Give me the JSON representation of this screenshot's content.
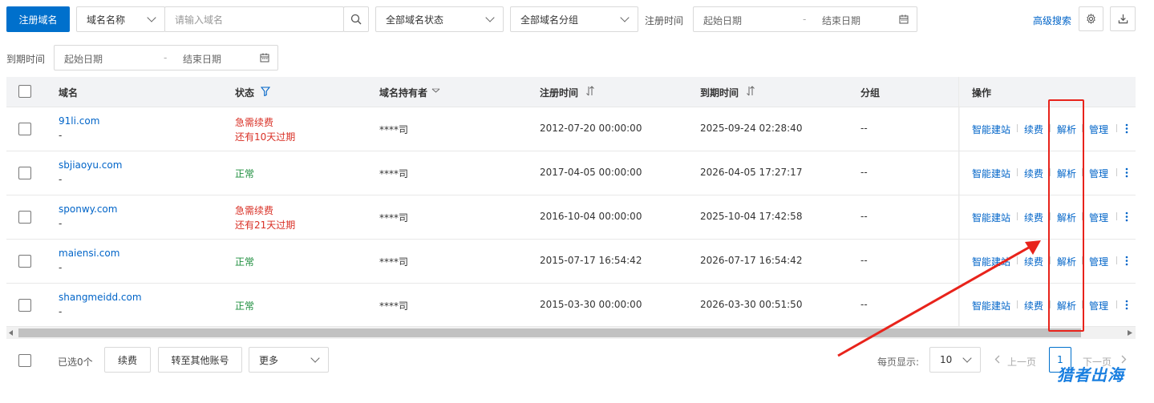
{
  "toolbar": {
    "register_label": "注册域名",
    "field_select": "域名名称",
    "search_placeholder": "请输入域名",
    "status_select": "全部域名状态",
    "group_select": "全部域名分组",
    "reg_time_label": "注册时间",
    "start_date": "起始日期",
    "dash": "-",
    "end_date": "结束日期",
    "advanced_search": "高级搜索",
    "expire_time_label": "到期时间"
  },
  "table": {
    "headers": {
      "domain": "域名",
      "status": "状态",
      "holder": "域名持有者",
      "reg_time": "注册时间",
      "expire_time": "到期时间",
      "group": "分组",
      "ops": "操作"
    },
    "ops": {
      "site": "智能建站",
      "renew": "续费",
      "dns": "解析",
      "manage": "管理"
    },
    "rows": [
      {
        "domain": "91li.com",
        "sub": "-",
        "status1": "急需续费",
        "status2": "还有10天过期",
        "holder": "****司",
        "reg": "2012-07-20 00:00:00",
        "exp": "2025-09-24 02:28:40",
        "group": "--"
      },
      {
        "domain": "sbjiaoyu.com",
        "sub": "-",
        "status1": "正常",
        "status2": "",
        "holder": "****司",
        "reg": "2017-04-05 00:00:00",
        "exp": "2026-04-05 17:27:17",
        "group": "--"
      },
      {
        "domain": "sponwy.com",
        "sub": "-",
        "status1": "急需续费",
        "status2": "还有21天过期",
        "holder": "****司",
        "reg": "2016-10-04 00:00:00",
        "exp": "2025-10-04 17:42:58",
        "group": "--"
      },
      {
        "domain": "maiensi.com",
        "sub": "-",
        "status1": "正常",
        "status2": "",
        "holder": "****司",
        "reg": "2015-07-17 16:54:42",
        "exp": "2026-07-17 16:54:42",
        "group": "--"
      },
      {
        "domain": "shangmeidd.com",
        "sub": "-",
        "status1": "正常",
        "status2": "",
        "holder": "****司",
        "reg": "2015-03-30 00:00:00",
        "exp": "2026-03-30 00:51:50",
        "group": "--"
      }
    ]
  },
  "footer": {
    "selected": "已选0个",
    "renew": "续费",
    "transfer": "转至其他账号",
    "more": "更多",
    "per_page_label": "每页显示:",
    "per_page": "10",
    "prev": "上一页",
    "page": "1",
    "next": "下一页"
  },
  "watermark": "猎者出海",
  "colors": {
    "primary": "#0070cc",
    "link": "#0064c8",
    "danger": "#d93026",
    "success": "#1e8e3e",
    "annotation": "#e8231b"
  }
}
